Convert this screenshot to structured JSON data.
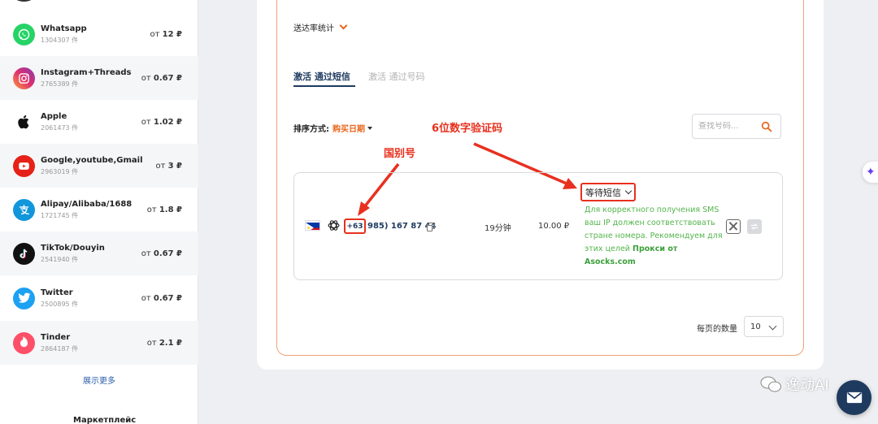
{
  "sidebar": {
    "items": [
      {
        "name": "Whatsapp",
        "count": "1304307 件",
        "price_prefix": "от",
        "price": "12 ₽",
        "icon": "whatsapp-icon",
        "color": "#25d366"
      },
      {
        "name": "Instagram+Threads",
        "count": "2765389 件",
        "price_prefix": "от",
        "price": "0.67 ₽",
        "icon": "instagram-icon",
        "color": "#d6249f"
      },
      {
        "name": "Apple",
        "count": "2061473 件",
        "price_prefix": "от",
        "price": "1.02 ₽",
        "icon": "apple-icon",
        "color": "#111111"
      },
      {
        "name": "Google,youtube,Gmail",
        "count": "2963019 件",
        "price_prefix": "от",
        "price": "3 ₽",
        "icon": "youtube-icon",
        "color": "#e62117"
      },
      {
        "name": "Alipay/Alibaba/1688",
        "count": "1721745 件",
        "price_prefix": "от",
        "price": "1.8 ₽",
        "icon": "alipay-icon",
        "color": "#1296db"
      },
      {
        "name": "TikTok/Douyin",
        "count": "2541940 件",
        "price_prefix": "от",
        "price": "0.67 ₽",
        "icon": "tiktok-icon",
        "color": "#111111"
      },
      {
        "name": "Twitter",
        "count": "2500895 件",
        "price_prefix": "от",
        "price": "0.67 ₽",
        "icon": "twitter-icon",
        "color": "#1da1f2"
      },
      {
        "name": "Tinder",
        "count": "2864187 件",
        "price_prefix": "от",
        "price": "2.1 ₽",
        "icon": "tinder-icon",
        "color": "#fd5068"
      }
    ],
    "show_more": "展示更多",
    "marketplace": "Маркетплейс"
  },
  "main": {
    "delivery_stats": "送达率统计",
    "tabs": [
      {
        "label": "激活 通过短信",
        "active": true
      },
      {
        "label": "激活 通过号码",
        "active": false
      }
    ],
    "sort_label": "排序方式:",
    "sort_value": "购买日期",
    "search_placeholder": "查找号码...",
    "order": {
      "country_flag": "philippines-flag-icon",
      "service_icon": "openai-icon",
      "country_code": "+63",
      "phone": "985) 167 87 44",
      "duration": "19分钟",
      "price": "10.00 ₽",
      "status": "等待短信",
      "note": "Для корректного получения SMS ваш IP должен соответствовать стране номера. Рекомендуем для этих целей",
      "note_link": "Прокси от Asocks.com"
    },
    "per_page_label": "每页的数量",
    "per_page_value": "10"
  },
  "annotations": {
    "country_code_label": "国别号",
    "code_label": "6位数字验证码"
  },
  "watermark": "逸动AI",
  "colors": {
    "accent": "#e8671e",
    "annotation": "#e8301e",
    "navy": "#1e3a5f",
    "note_green": "#52b54b"
  }
}
